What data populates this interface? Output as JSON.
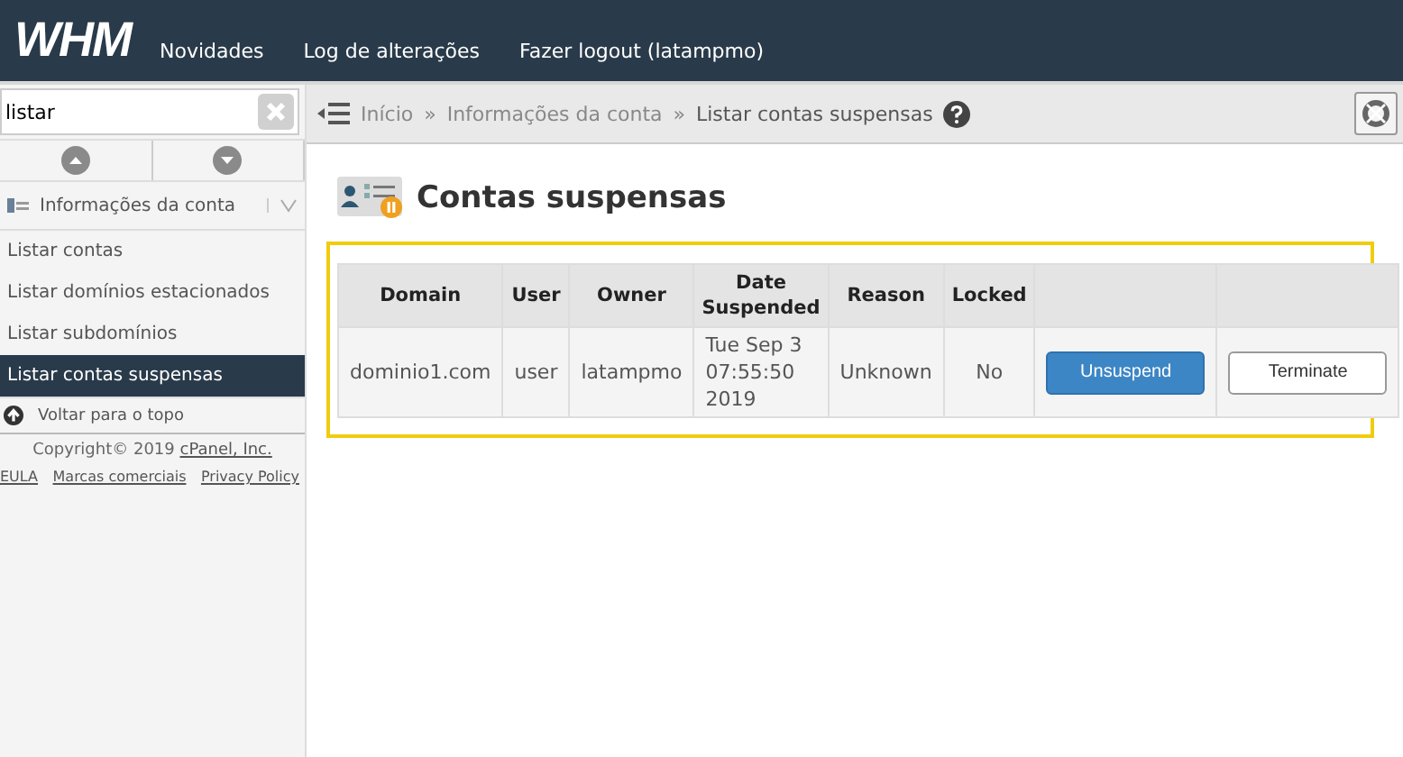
{
  "header": {
    "logo": "WHM",
    "links": [
      "Novidades",
      "Log de alterações",
      "Fazer logout (latampmo)"
    ]
  },
  "sidebar": {
    "search": {
      "value": "listar"
    },
    "section": {
      "label": "Informações da conta",
      "expanded": true
    },
    "items": [
      {
        "label": "Listar contas",
        "selected": false
      },
      {
        "label": "Listar domínios estacionados",
        "selected": false
      },
      {
        "label": "Listar subdomínios",
        "selected": false
      },
      {
        "label": "Listar contas suspensas",
        "selected": true
      }
    ],
    "back_to_top": "Voltar para o topo",
    "copyright": "Copyright© 2019",
    "company_link": "cPanel, Inc.",
    "footer_links": [
      "EULA",
      "Marcas comerciais",
      "Privacy Policy"
    ]
  },
  "breadcrumb": [
    "Início",
    "Informações da conta",
    "Listar contas suspensas"
  ],
  "breadcrumb_separator": "»",
  "page_title": "Contas suspensas",
  "table": {
    "columns": [
      "Domain",
      "User",
      "Owner",
      "Date Suspended",
      "Reason",
      "Locked",
      "",
      ""
    ],
    "rows": [
      {
        "cells": [
          "dominio1.com",
          "user",
          "latampmo",
          "Tue Sep 3 07:55:50 2019",
          "Unknown",
          "No"
        ],
        "actions": [
          {
            "label": "Unsuspend",
            "kind": "primary"
          },
          {
            "label": "Terminate",
            "kind": "default"
          }
        ]
      }
    ]
  }
}
